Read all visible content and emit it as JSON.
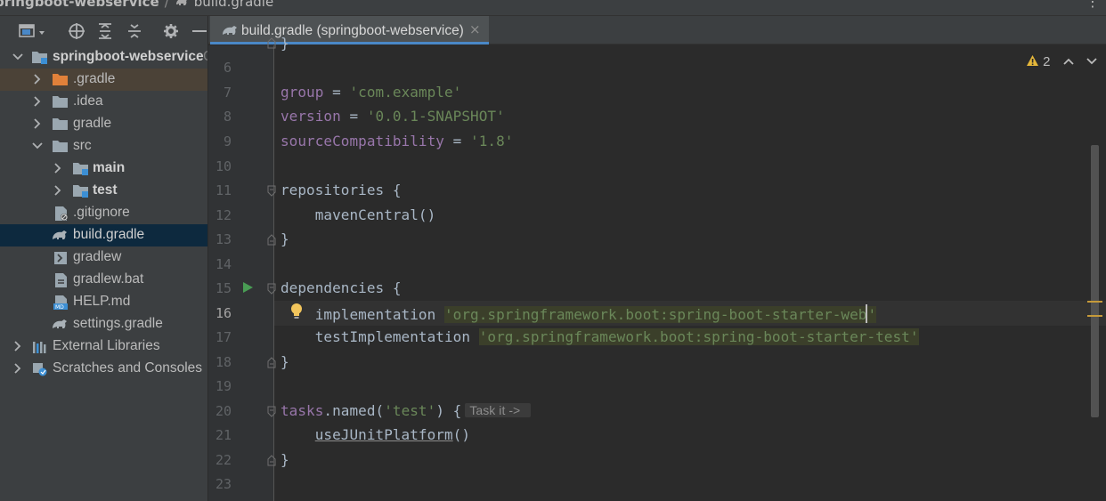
{
  "window": {
    "breadcrumb": [
      "pringboot-webservice",
      "build.gradle"
    ],
    "more": "⋮"
  },
  "sidebar": {
    "toolbar": [
      {
        "icon": "project-view-icon"
      },
      {
        "icon": "crosshair-icon"
      },
      {
        "icon": "expand-all-icon"
      },
      {
        "icon": "collapse-all-icon"
      },
      {
        "icon": "gear-icon"
      },
      {
        "icon": "hide-icon"
      }
    ],
    "tree": [
      {
        "label": "springboot-webservice",
        "icon": "project-folder-icon",
        "expanded": true
      },
      {
        "label": ".gradle",
        "icon": "excluded-folder-icon"
      },
      {
        "label": ".idea",
        "icon": "folder-icon"
      },
      {
        "label": "gradle",
        "icon": "folder-icon"
      },
      {
        "label": "src",
        "icon": "folder-icon",
        "expanded": true
      },
      {
        "label": "main",
        "icon": "source-folder-icon"
      },
      {
        "label": "test",
        "icon": "source-folder-icon"
      },
      {
        "label": ".gitignore",
        "icon": "gitignore-file-icon"
      },
      {
        "label": "build.gradle",
        "icon": "gradle-file-icon",
        "selected": true
      },
      {
        "label": "gradlew",
        "icon": "shell-script-icon"
      },
      {
        "label": "gradlew.bat",
        "icon": "batch-file-icon"
      },
      {
        "label": "HELP.md",
        "icon": "markdown-file-icon"
      },
      {
        "label": "settings.gradle",
        "icon": "gradle-file-icon"
      },
      {
        "label": "External Libraries",
        "icon": "libraries-icon"
      },
      {
        "label": "Scratches and Consoles",
        "icon": "scratches-icon"
      }
    ],
    "project_suffix": "C"
  },
  "editor": {
    "tab": {
      "label": "build.gradle (springboot-webservice)",
      "close": "×"
    },
    "inspection": {
      "count": "2"
    },
    "lines": [
      {
        "n": "6",
        "text": "}"
      },
      {
        "n": "7",
        "parts": [
          "group",
          " = ",
          "'com.example'"
        ]
      },
      {
        "n": "8",
        "parts": [
          "version",
          " = ",
          "'0.0.1-SNAPSHOT'"
        ]
      },
      {
        "n": "9",
        "parts": [
          "sourceCompatibility",
          " = ",
          "'1.8'"
        ]
      },
      {
        "n": "10"
      },
      {
        "n": "11",
        "text": "repositories {"
      },
      {
        "n": "12",
        "text": "    mavenCentral()"
      },
      {
        "n": "13",
        "text": "}"
      },
      {
        "n": "14"
      },
      {
        "n": "15",
        "text": "dependencies {"
      },
      {
        "n": "16",
        "parts": [
          "    implementation ",
          "'org.springframework.boot:spring-boot-starter-web",
          "'"
        ]
      },
      {
        "n": "17",
        "parts": [
          "    testImplementation ",
          "'org.springframework.boot:spring-boot-starter-test'"
        ]
      },
      {
        "n": "18",
        "text": "}"
      },
      {
        "n": "19"
      },
      {
        "n": "20",
        "parts": [
          "tasks",
          ".named(",
          "'test'",
          ") {",
          "Task it ->"
        ]
      },
      {
        "n": "21",
        "parts": [
          "    ",
          "useJUnitPlatform",
          "()"
        ]
      },
      {
        "n": "22",
        "text": "}"
      },
      {
        "n": "23"
      }
    ]
  },
  "colors": {
    "keyword": "#9876aa",
    "string": "#6a8759",
    "text": "#a9b7c6",
    "selection": "#0d293e",
    "tab_underline": "#4a88c7",
    "warning": "#e5b73a"
  }
}
